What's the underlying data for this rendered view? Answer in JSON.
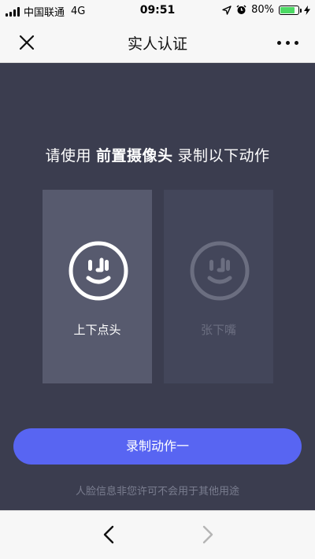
{
  "status_bar": {
    "carrier": "中国联通",
    "network": "4G",
    "time": "09:51",
    "battery_percent": "80%",
    "battery_level": 0.8,
    "battery_color": "#4cd964",
    "icons": [
      "signal-icon",
      "location-icon",
      "alarm-icon",
      "battery-icon",
      "charging-icon"
    ]
  },
  "nav": {
    "title": "实人认证",
    "close_icon": "close-icon",
    "more_icon": "more-icon"
  },
  "main": {
    "instruction": {
      "prefix": "请使用",
      "highlight": "前置摄像头",
      "suffix": "录制以下动作"
    },
    "actions": [
      {
        "label": "上下点头",
        "icon": "face-icon",
        "active": true
      },
      {
        "label": "张下嘴",
        "icon": "face-icon",
        "active": false
      }
    ],
    "record_button": "录制动作一",
    "privacy_note": "人脸信息非您许可不会用于其他用途",
    "accent_color": "#5865f2"
  },
  "toolbar": {
    "back_icon": "chevron-left-icon",
    "forward_icon": "chevron-right-icon"
  }
}
